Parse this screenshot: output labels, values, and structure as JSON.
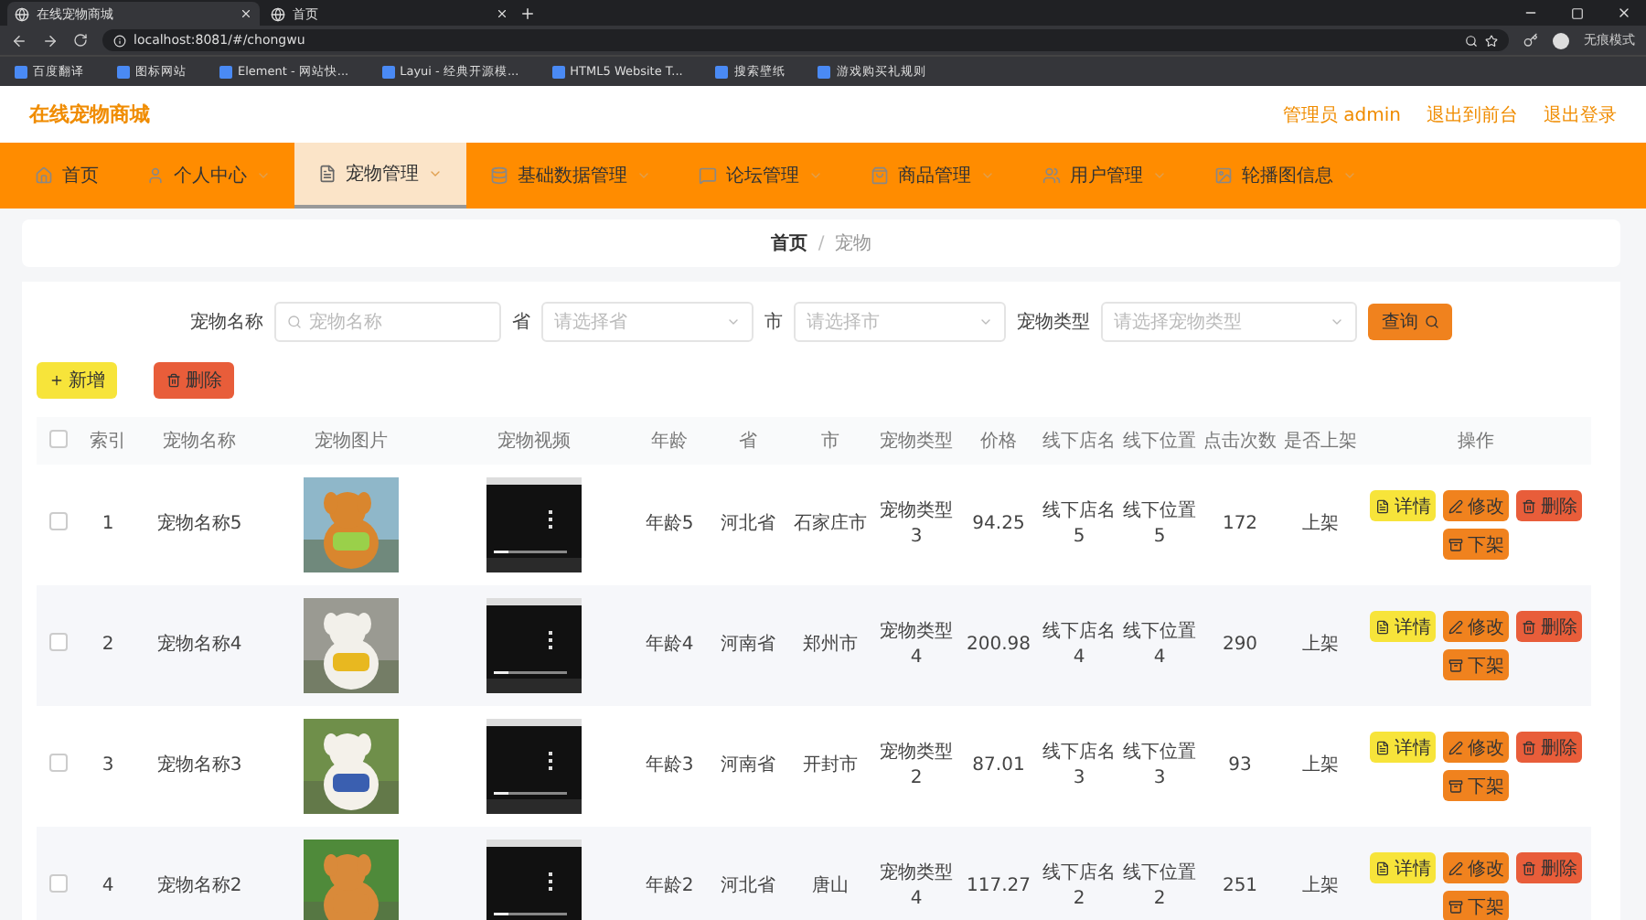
{
  "browser": {
    "tabs": [
      {
        "title": "在线宠物商城",
        "selected": true
      },
      {
        "title": "首页",
        "selected": false
      }
    ],
    "url": "localhost:8081/#/chongwu",
    "bookmarks": [
      "百度翻译",
      "图标网站",
      "Element - 网站快...",
      "Layui - 经典开源模...",
      "HTML5 Website T...",
      "搜索壁纸",
      "游戏购买礼规则"
    ],
    "profile": "无痕模式"
  },
  "header": {
    "site_title": "在线宠物商城",
    "links": [
      "管理员 admin",
      "退出到前台",
      "退出登录"
    ]
  },
  "nav": [
    {
      "label": "首页",
      "selected": false,
      "dropdown": false
    },
    {
      "label": "个人中心",
      "selected": false,
      "dropdown": true
    },
    {
      "label": "宠物管理",
      "selected": true,
      "dropdown": true
    },
    {
      "label": "基础数据管理",
      "selected": false,
      "dropdown": true
    },
    {
      "label": "论坛管理",
      "selected": false,
      "dropdown": true
    },
    {
      "label": "商品管理",
      "selected": false,
      "dropdown": true
    },
    {
      "label": "用户管理",
      "selected": false,
      "dropdown": true
    },
    {
      "label": "轮播图信息",
      "selected": false,
      "dropdown": true
    }
  ],
  "breadcrumb": {
    "items": [
      "首页",
      "宠物"
    ],
    "separator": "/"
  },
  "filters": [
    {
      "label": "宠物名称",
      "kind": "input",
      "placeholder": "宠物名称"
    },
    {
      "label": "省",
      "kind": "select",
      "placeholder": "请选择省"
    },
    {
      "label": "市",
      "kind": "select",
      "placeholder": "请选择市"
    },
    {
      "label": "宠物类型",
      "kind": "select",
      "placeholder": "请选择宠物类型"
    }
  ],
  "search_button": "查询",
  "actions": [
    {
      "label": "新增",
      "kind": "add"
    },
    {
      "label": "删除",
      "kind": "delete"
    }
  ],
  "table": {
    "all_checked": false,
    "columns": [
      "索引",
      "宠物名称",
      "宠物图片",
      "宠物视频",
      "年龄",
      "省",
      "市",
      "宠物类型",
      "价格",
      "线下店名",
      "线下位置",
      "点击次数",
      "是否上架",
      "操作"
    ],
    "rows": [
      {
        "checked": false,
        "index": "1",
        "name": "宠物名称5",
        "age": "年龄5",
        "province": "河北省",
        "city": "石家庄市",
        "type": "宠物类型3",
        "price": "94.25",
        "store": "线下店名5",
        "location": "线下位置5",
        "clicks": "172",
        "status": "上架",
        "actions": [
          {
            "label": "详情",
            "kind": "detail"
          },
          {
            "label": "修改",
            "kind": "edit"
          },
          {
            "label": "删除",
            "kind": "delete"
          },
          {
            "label": "下架",
            "kind": "offshelf"
          }
        ]
      },
      {
        "checked": false,
        "index": "2",
        "name": "宠物名称4",
        "age": "年龄4",
        "province": "河南省",
        "city": "郑州市",
        "type": "宠物类型4",
        "price": "200.98",
        "store": "线下店名4",
        "location": "线下位置4",
        "clicks": "290",
        "status": "上架",
        "actions": [
          {
            "label": "详情",
            "kind": "detail"
          },
          {
            "label": "修改",
            "kind": "edit"
          },
          {
            "label": "删除",
            "kind": "delete"
          },
          {
            "label": "下架",
            "kind": "offshelf"
          }
        ]
      },
      {
        "checked": false,
        "index": "3",
        "name": "宠物名称3",
        "age": "年龄3",
        "province": "河南省",
        "city": "开封市",
        "type": "宠物类型2",
        "price": "87.01",
        "store": "线下店名3",
        "location": "线下位置3",
        "clicks": "93",
        "status": "上架",
        "actions": [
          {
            "label": "详情",
            "kind": "detail"
          },
          {
            "label": "修改",
            "kind": "edit"
          },
          {
            "label": "删除",
            "kind": "delete"
          },
          {
            "label": "下架",
            "kind": "offshelf"
          }
        ]
      },
      {
        "checked": false,
        "index": "4",
        "name": "宠物名称2",
        "age": "年龄2",
        "province": "河北省",
        "city": "唐山",
        "type": "宠物类型4",
        "price": "117.27",
        "store": "线下店名2",
        "location": "线下位置2",
        "clicks": "251",
        "status": "上架",
        "actions": [
          {
            "label": "详情",
            "kind": "detail"
          },
          {
            "label": "修改",
            "kind": "edit"
          },
          {
            "label": "删除",
            "kind": "delete"
          },
          {
            "label": "下架",
            "kind": "offshelf"
          }
        ]
      }
    ]
  }
}
